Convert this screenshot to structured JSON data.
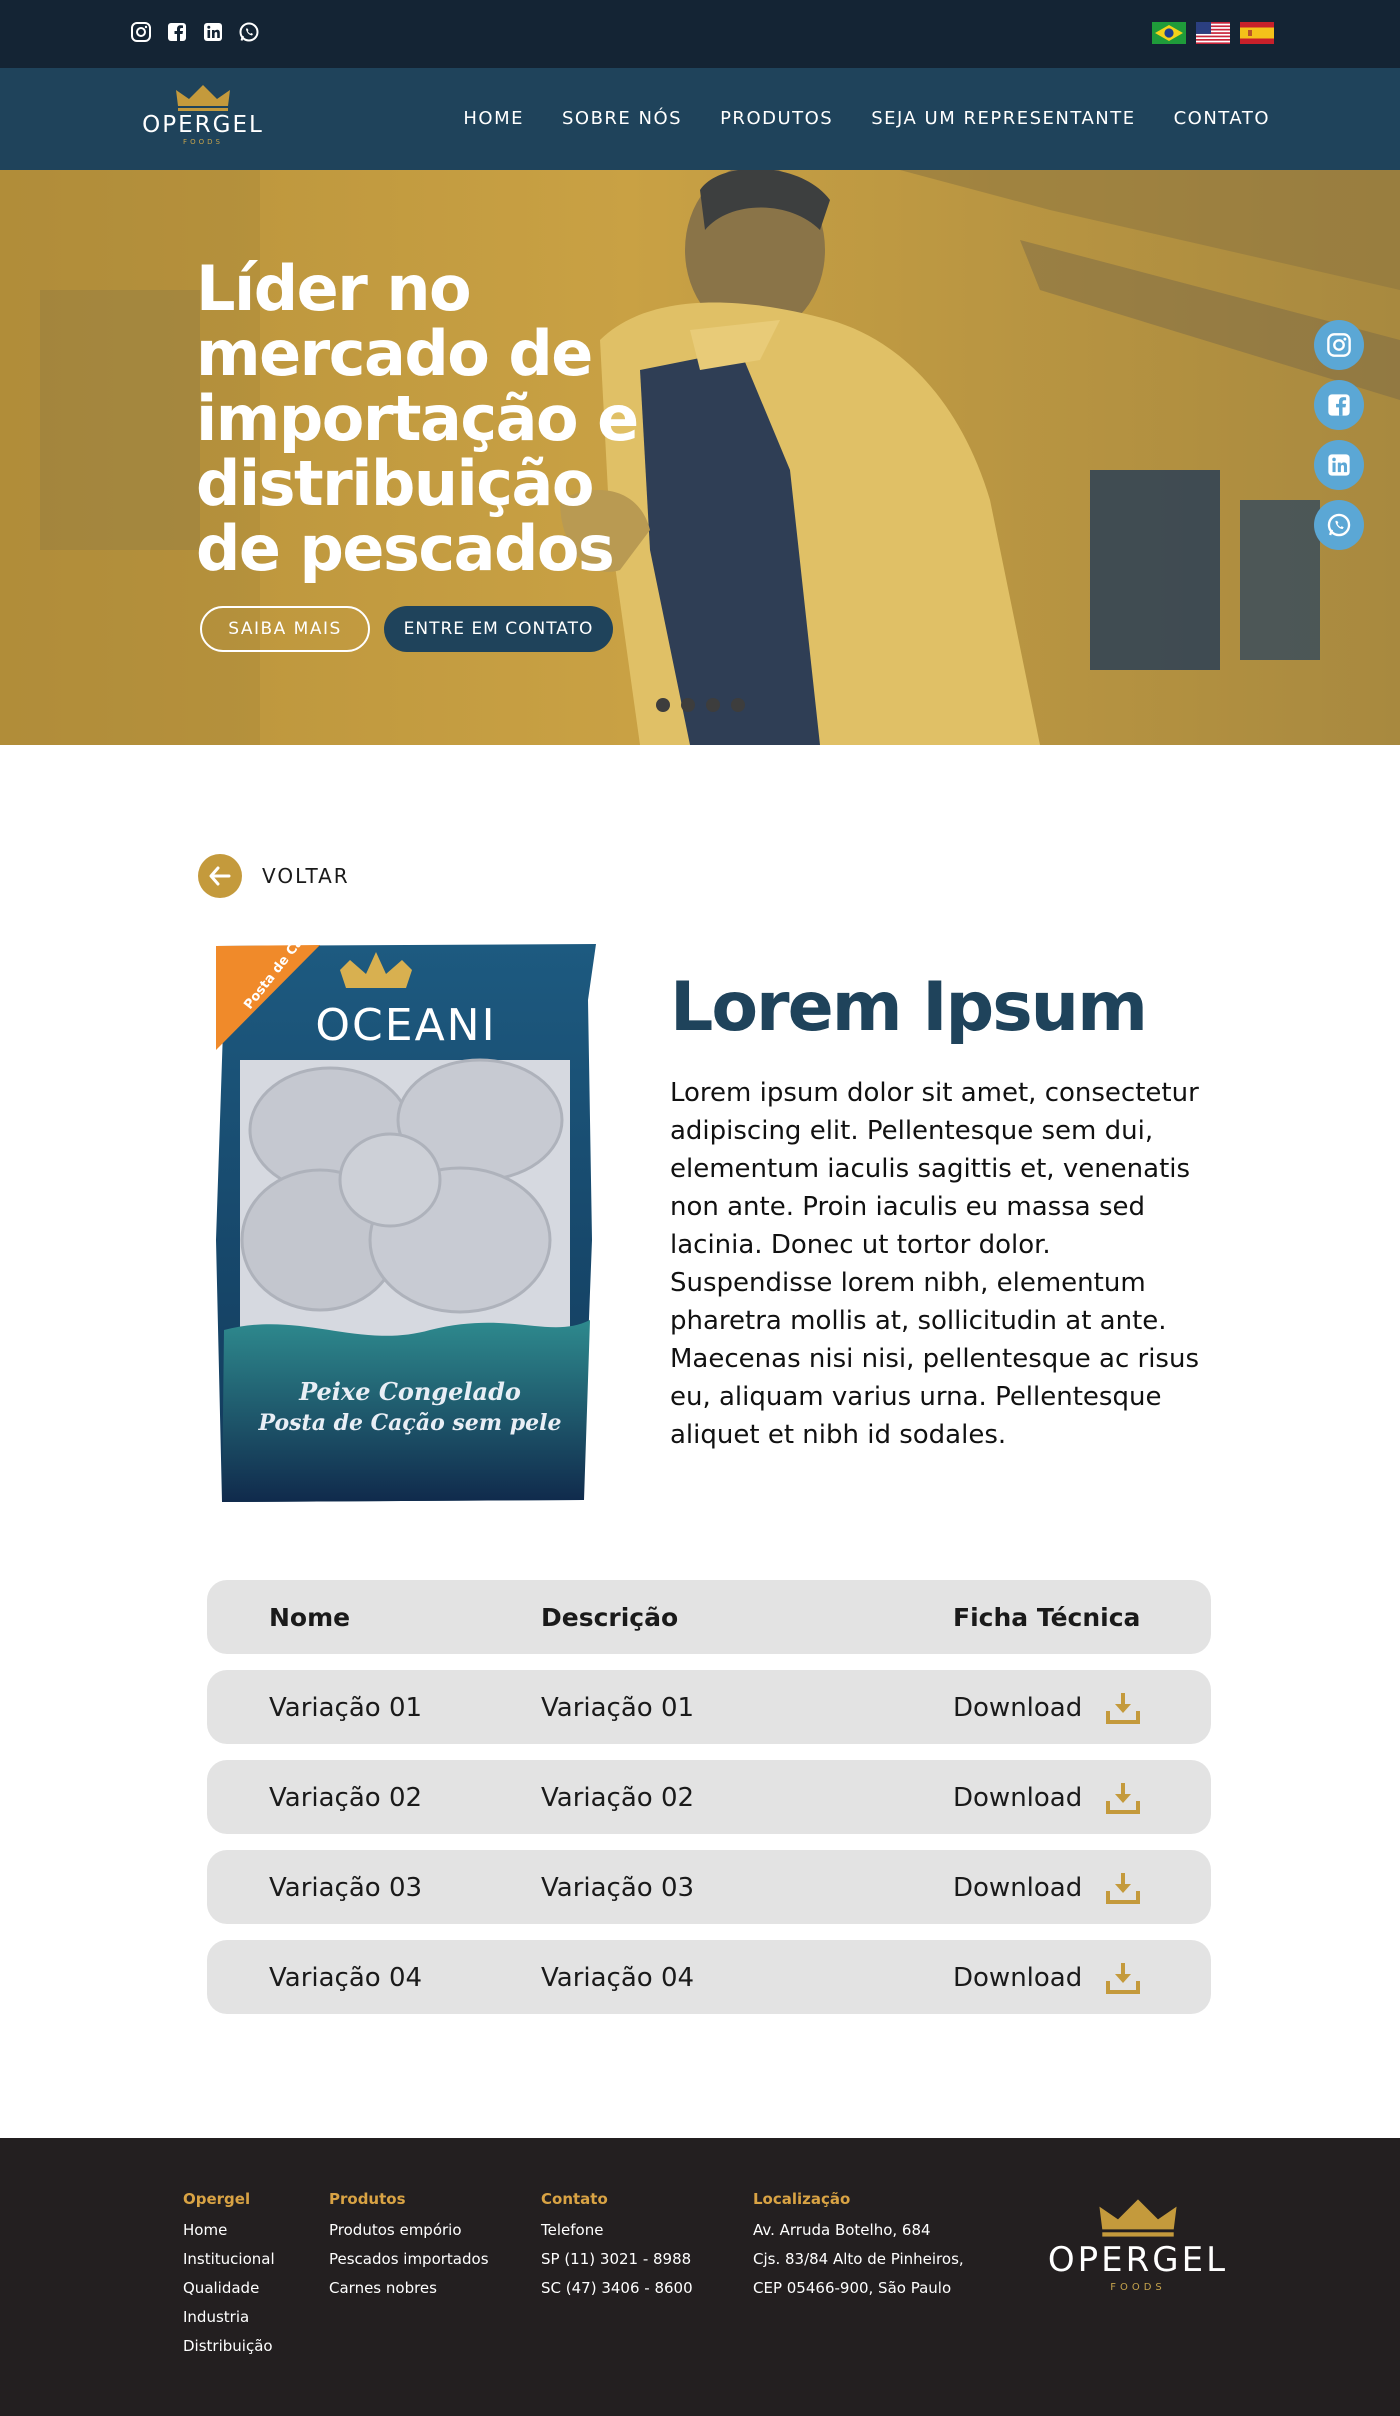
{
  "topbar": {
    "social_icons": [
      "instagram-icon",
      "facebook-icon",
      "linkedin-icon",
      "whatsapp-icon"
    ],
    "flags": [
      "brazil-flag",
      "usa-flag",
      "spain-flag"
    ]
  },
  "brand": {
    "name": "OPERGEL",
    "sub": "FOODS",
    "gold": "#c49a3c",
    "navy": "#1f435b",
    "dark": "#142434"
  },
  "nav": {
    "items": [
      "HOME",
      "SOBRE NÓS",
      "PRODUTOS",
      "SEJA UM REPRESENTANTE",
      "CONTATO"
    ]
  },
  "hero": {
    "title_lines": [
      "Líder no",
      "mercado de",
      "importação e",
      "distribuição",
      "de pescados"
    ],
    "btn_primary": "SAIBA MAIS",
    "btn_secondary": "ENTRE EM CONTATO",
    "slides": 4
  },
  "back": {
    "label": "VOLTAR"
  },
  "product": {
    "title": "Lorem Ipsum",
    "description": "Lorem ipsum dolor sit amet, consectetur adipiscing elit. Pellentesque sem dui, elementum iaculis sagittis et, venenatis non ante. Proin iaculis eu massa sed lacinia. Donec ut tortor dolor. Suspendisse lorem nibh, elementum pharetra mollis at, sollicitudin at ante. Maecenas nisi nisi, pellentesque ac risus eu, aliquam varius urna. Pellentesque aliquet et nibh id sodales.",
    "package": {
      "brand": "OCEANI",
      "corner": "Posta de Cação",
      "line1": "Peixe Congelado",
      "line2": "Posta de Cação sem pele"
    }
  },
  "table": {
    "headers": [
      "Nome",
      "Descrição",
      "Ficha Técnica"
    ],
    "rows": [
      {
        "nome": "Variação 01",
        "descricao": "Variação 01",
        "ficha": "Download"
      },
      {
        "nome": "Variação 02",
        "descricao": "Variação 02",
        "ficha": "Download"
      },
      {
        "nome": "Variação 03",
        "descricao": "Variação 03",
        "ficha": "Download"
      },
      {
        "nome": "Variação 04",
        "descricao": "Variação 04",
        "ficha": "Download"
      }
    ]
  },
  "footer": {
    "columns": [
      {
        "heading": "Opergel",
        "items": [
          "Home",
          "Institucional",
          "Qualidade",
          "Industria",
          "Distribuição"
        ]
      },
      {
        "heading": "Produtos",
        "items": [
          "Produtos empório",
          "Pescados importados",
          "Carnes nobres"
        ]
      },
      {
        "heading": "Contato",
        "items": [
          "Telefone",
          "SP (11) 3021 - 8988",
          "SC (47) 3406 - 8600"
        ]
      },
      {
        "heading": "Localização",
        "items": [
          "Av. Arruda Botelho, 684",
          "Cjs. 83/84 Alto de Pinheiros,",
          "CEP 05466-900, São Paulo"
        ]
      }
    ]
  }
}
